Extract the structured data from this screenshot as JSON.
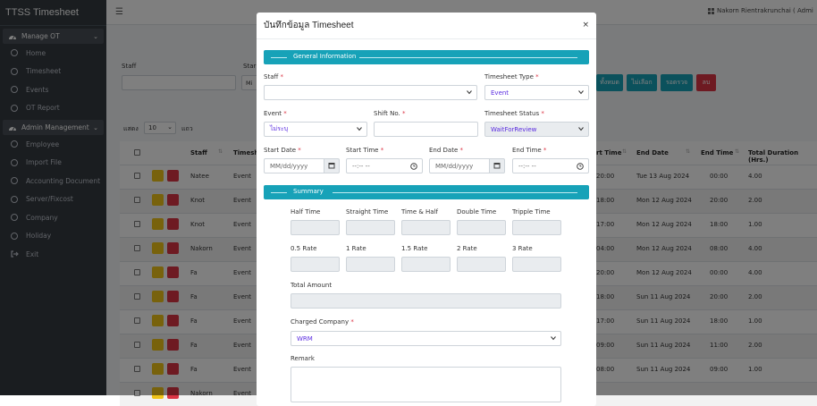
{
  "app": {
    "title": "TTSS Timesheet"
  },
  "sidebar": {
    "manage_head": "Manage OT",
    "manage_items": [
      {
        "label": "Home"
      },
      {
        "label": "Timesheet"
      },
      {
        "label": "Events"
      },
      {
        "label": "OT Report"
      }
    ],
    "admin_head": "Admin Management",
    "admin_items": [
      {
        "label": "Employee"
      },
      {
        "label": "Import File"
      },
      {
        "label": "Accounting Document"
      },
      {
        "label": "Server/Fixcost"
      },
      {
        "label": "Company"
      },
      {
        "label": "Holiday"
      }
    ],
    "exit_label": "Exit"
  },
  "topbar": {
    "user": "Nakorn Rientrakrunchai ( Admi"
  },
  "filters": {
    "staff_label": "Staff",
    "type_label_partial": "Star",
    "type_value_partial": "Mi",
    "buttons": {
      "all": "ทั้งหมด",
      "select": "ไม่เลือก",
      "wait": "รอตรวจ",
      "delete": "ลบ"
    },
    "colors": {
      "teal": "#17a2b8",
      "red": "#dc3545"
    }
  },
  "paging": {
    "show": "แสดง",
    "value": "10",
    "rows": "แถว"
  },
  "table": {
    "headers": {
      "staff": "Staff",
      "type": "Timesh",
      "start_time": "rt Time",
      "end_date": "End Date",
      "end_time": "End Time",
      "duration": "Total Duration (Hrs.)"
    },
    "rows": [
      {
        "staff": "Natee",
        "type": "Event",
        "start_time": "20:00",
        "end_date": "Tue 13 Aug 2024",
        "end_time": "00:00",
        "duration": "4.00"
      },
      {
        "staff": "Knot",
        "type": "Event",
        "start_time": "18:00",
        "end_date": "Mon 12 Aug 2024",
        "end_time": "20:00",
        "duration": "2.00"
      },
      {
        "staff": "Knot",
        "type": "Event",
        "start_time": "17:00",
        "end_date": "Mon 12 Aug 2024",
        "end_time": "18:00",
        "duration": "1.00"
      },
      {
        "staff": "Nakorn",
        "type": "Event",
        "start_time": "04:00",
        "end_date": "Mon 12 Aug 2024",
        "end_time": "08:00",
        "duration": "4.00"
      },
      {
        "staff": "Fa",
        "type": "Event",
        "start_time": "20:00",
        "end_date": "Mon 12 Aug 2024",
        "end_time": "00:00",
        "duration": "4.00"
      },
      {
        "staff": "Fa",
        "type": "Event",
        "start_time": "18:00",
        "end_date": "Sun 11 Aug 2024",
        "end_time": "20:00",
        "duration": "2.00"
      },
      {
        "staff": "Fa",
        "type": "Event",
        "start_time": "17:00",
        "end_date": "Sun 11 Aug 2024",
        "end_time": "18:00",
        "duration": "1.00"
      },
      {
        "staff": "Fa",
        "type": "Event",
        "start_time": "09:00",
        "end_date": "Sun 11 Aug 2024",
        "end_time": "11:00",
        "duration": "2.00"
      },
      {
        "staff": "Fa",
        "type": "Event",
        "start_time": "08:00",
        "end_date": "Sun 11 Aug 2024",
        "end_time": "09:00",
        "duration": "1.00"
      },
      {
        "staff": "Nakorn",
        "type": "Event",
        "start_time": "",
        "end_date": "",
        "end_time": "",
        "duration": ""
      }
    ]
  },
  "modal": {
    "title": "บันทึกข้อมูล Timesheet",
    "close": "×",
    "general_section": "General Information",
    "staff_label": "Staff",
    "type_label": "Timesheet Type",
    "type_value": "Event",
    "event_label": "Event",
    "event_value": "ไม่ระบุ",
    "shift_label": "Shift No.",
    "status_label": "Timesheet Status",
    "status_value": "WaitForReview",
    "start_date_label": "Start Date",
    "start_time_label": "Start Time",
    "end_date_label": "End Date",
    "end_time_label": "End Time",
    "date_placeholder": "MM/dd/yyyy",
    "time_placeholder": "--:-- --",
    "required_mark": "*",
    "summary_section": "Summary",
    "summary_row1": [
      "Half Time",
      "Straight Time",
      "Time & Half",
      "Double Time",
      "Tripple Time"
    ],
    "summary_row2": [
      "0.5 Rate",
      "1 Rate",
      "1.5 Rate",
      "2 Rate",
      "3 Rate"
    ],
    "total_label": "Total Amount",
    "company_label": "Charged Company",
    "company_value": "WRM",
    "remark_label": "Remark",
    "accent": "#5a2be0"
  }
}
